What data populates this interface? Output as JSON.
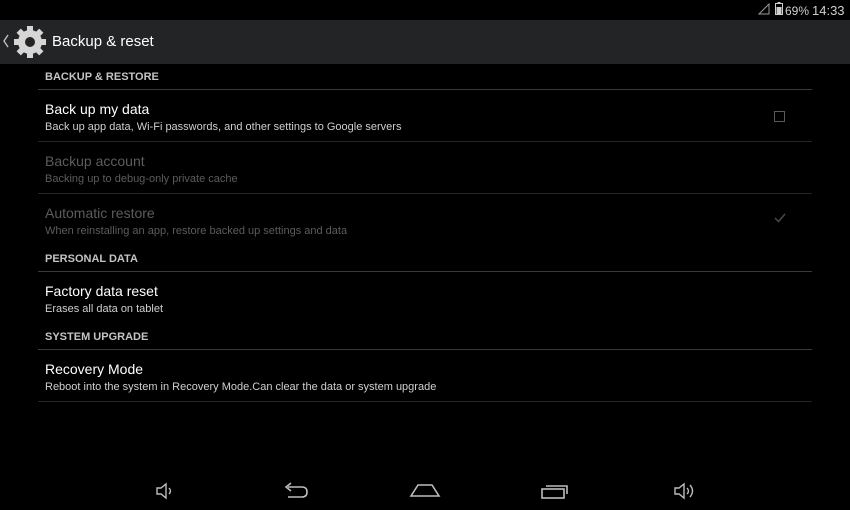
{
  "status_bar": {
    "battery": "69%",
    "time": "14:33",
    "icons": [
      "signal-icon",
      "battery-icon"
    ]
  },
  "action_bar": {
    "title": "Backup & reset",
    "icons": [
      "chevron-left-icon",
      "gear-icon"
    ]
  },
  "sections": [
    {
      "header": "BACKUP & RESTORE",
      "items": [
        {
          "title": "Back up my data",
          "summary": "Back up app data, Wi-Fi passwords, and other settings to Google servers",
          "checked": false,
          "enabled": true
        },
        {
          "title": "Backup account",
          "summary": "Backing up to debug-only private cache",
          "enabled": false
        },
        {
          "title": "Automatic restore",
          "summary": "When reinstalling an app, restore backed up settings and data",
          "checked": true,
          "enabled": false
        }
      ]
    },
    {
      "header": "PERSONAL DATA",
      "items": [
        {
          "title": "Factory data reset",
          "summary": "Erases all data on tablet",
          "enabled": true
        }
      ]
    },
    {
      "header": "SYSTEM UPGRADE",
      "items": [
        {
          "title": "Recovery Mode",
          "summary": "Reboot into the system in Recovery Mode.Can clear the data or system upgrade",
          "enabled": true
        }
      ]
    }
  ],
  "nav_bar": {
    "buttons": [
      "volume-down-icon",
      "back-icon",
      "home-icon",
      "recent-apps-icon",
      "volume-up-icon"
    ]
  },
  "colors": {
    "background": "#000000",
    "action_bar": "#222426",
    "text_primary": "#ffffff",
    "text_secondary": "#cfcfcf",
    "text_disabled": "#5c5c5c"
  }
}
